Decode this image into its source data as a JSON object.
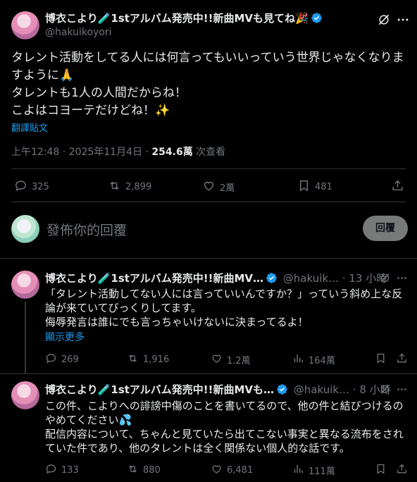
{
  "main_tweet": {
    "author_name": "博衣こより🧪1stアルバム発売中!!新曲MVも見てね🎉",
    "handle": "@hakuikoyori",
    "text_lines": [
      "タレント活動をしてる人には何言ってもいいっていう世界じゃなくなりま",
      "すように🙏",
      "タレントも1人の人間だからね！",
      "こよはコヨーテだけどね！✨"
    ],
    "translate": "翻譯貼文",
    "time": "上午12:48 · 2025年11月4日 · ",
    "views_count": "254.6萬",
    "views_label": " 次查看",
    "replies": "325",
    "retweets": "2,899",
    "likes": "2萬",
    "bookmarks": "481"
  },
  "composer": {
    "placeholder": "發佈你的回覆",
    "button": "回覆"
  },
  "replies": [
    {
      "author_name": "博衣こより🧪1stアルバム発売中!!新曲MV…",
      "handle": "@hakuik…",
      "time": "· 13 小時",
      "text_lines": [
        "「タレント活動してない人には言っていいんですか？」っていう斜め上な反",
        "論が来ていてびっくりしてます。",
        "侮辱発言は誰にでも言っちゃいけないに決まってるよ！"
      ],
      "show_more": "顯示更多",
      "replies": "269",
      "retweets": "1,916",
      "likes": "1.2萬",
      "views": "164萬"
    },
    {
      "author_name": "博衣こより🧪1stアルバム発売中!!新曲MVも…",
      "handle": "@hakuik…",
      "time": "· 8 小時",
      "text_lines": [
        "この件、こよりへの誹謗中傷のことを書いてるので、他の件と結びつけるの",
        "やめてください💦",
        "配信内容について、ちゃんと見ていたら出てこない事実と異なる流布をされ",
        "ていた件であり、他のタレントは全く関係ない個人的な話です。"
      ],
      "replies": "133",
      "retweets": "880",
      "likes": "6,481",
      "views": "111萬"
    }
  ]
}
